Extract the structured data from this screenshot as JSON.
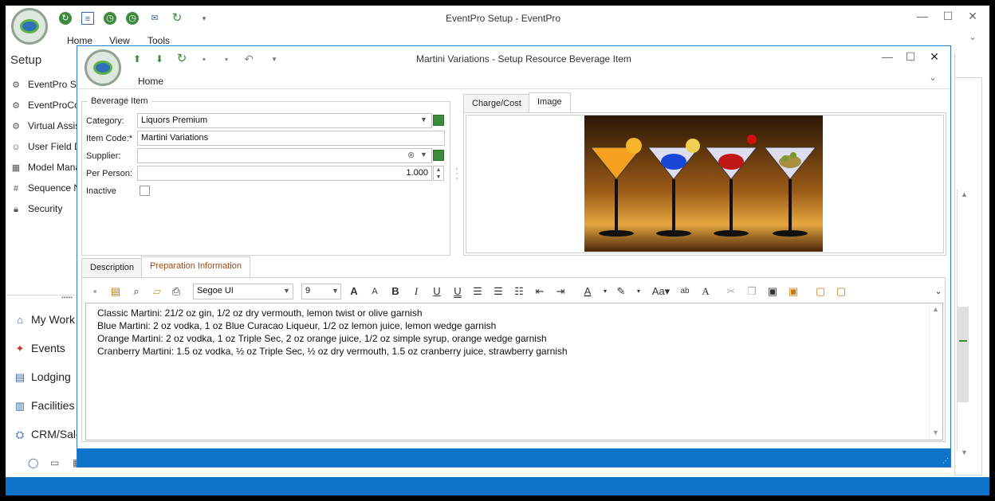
{
  "app": {
    "title": "EventPro Setup - EventPro",
    "menus": [
      "Home",
      "View",
      "Tools"
    ],
    "section": "Setup"
  },
  "sidebar": {
    "items": [
      {
        "label": "EventPro Se",
        "icon": "gear-icon"
      },
      {
        "label": "EventProCon",
        "icon": "gear-icon"
      },
      {
        "label": "Virtual Assist",
        "icon": "gear-icon"
      },
      {
        "label": "User Field De",
        "icon": "user-icon"
      },
      {
        "label": "Model Manag",
        "icon": "model-icon"
      },
      {
        "label": "Sequence Nu",
        "icon": "hash-icon"
      },
      {
        "label": "Security",
        "icon": "lock-icon"
      }
    ]
  },
  "nav": {
    "items": [
      {
        "label": "My Work",
        "icon": "home-icon"
      },
      {
        "label": "Events",
        "icon": "events-icon"
      },
      {
        "label": "Lodging",
        "icon": "lodging-icon"
      },
      {
        "label": "Facilities",
        "icon": "facilities-icon"
      },
      {
        "label": "CRM/Sale",
        "icon": "crm-icon"
      }
    ]
  },
  "dialog": {
    "title": "Martini Variations - Setup Resource Beverage Item",
    "menu": "Home",
    "group_title": "Beverage Item",
    "fields": {
      "category_label": "Category:",
      "category_value": "Liquors Premium",
      "item_code_label": "Item Code:*",
      "item_code_value": "Martini Variations",
      "supplier_label": "Supplier:",
      "supplier_value": "",
      "per_person_label": "Per Person:",
      "per_person_value": "1.000",
      "inactive_label": "Inactive"
    },
    "top_tabs": [
      "Charge/Cost",
      "Image"
    ],
    "bottom_tabs": [
      "Description",
      "Preparation Information"
    ],
    "editor": {
      "font": "Segoe UI",
      "size": "9",
      "lines": [
        "Classic Martini: 21/2 oz gin, 1/2 oz dry vermouth, lemon twist or olive garnish",
        "Blue Martini: 2 oz vodka, 1 oz Blue Curacao Liqueur, 1/2 oz lemon juice, lemon wedge garnish",
        "Orange Martini: 2 oz vodka, 1 oz Triple Sec, 2 oz orange juice, 1/2 oz simple syrup, orange wedge garnish",
        "Cranberry Martini: 1.5 oz vodka, ½ oz Triple Sec, ½ oz dry vermouth, 1.5 oz cranberry juice, strawberry garnish"
      ]
    }
  },
  "colors": {
    "accent": "#0f73c9",
    "border": "#2b79d0"
  }
}
